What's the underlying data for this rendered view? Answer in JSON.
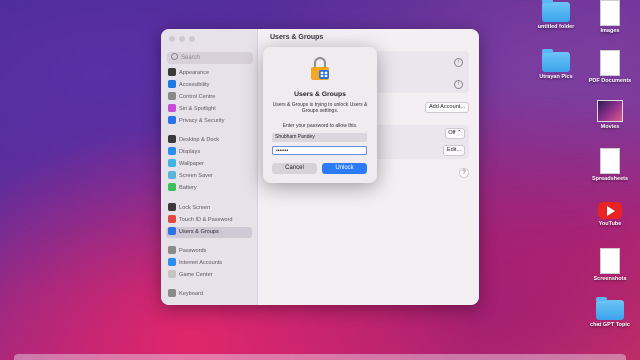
{
  "window": {
    "search_placeholder": "Search",
    "title": "Users & Groups",
    "sidebar": [
      {
        "label": "Appearance",
        "color": "#3a3a3a"
      },
      {
        "label": "Accessibility",
        "color": "#1f7ae0"
      },
      {
        "label": "Control Centre",
        "color": "#8a8a8a"
      },
      {
        "label": "Siri & Spotlight",
        "color": "#c94bd6"
      },
      {
        "label": "Privacy & Security",
        "color": "#2c74e6"
      },
      {
        "label": "Desktop & Dock",
        "color": "#3a3a3a"
      },
      {
        "label": "Displays",
        "color": "#2c8df0"
      },
      {
        "label": "Wallpaper",
        "color": "#3fb6e0"
      },
      {
        "label": "Screen Saver",
        "color": "#58b7d8"
      },
      {
        "label": "Battery",
        "color": "#39c15c"
      },
      {
        "label": "Lock Screen",
        "color": "#3a3a3a"
      },
      {
        "label": "Touch ID & Password",
        "color": "#e2483f"
      },
      {
        "label": "Users & Groups",
        "color": "#2c74e6"
      },
      {
        "label": "Passwords",
        "color": "#8a8a8a"
      },
      {
        "label": "Internet Accounts",
        "color": "#2c8df0"
      },
      {
        "label": "Game Center",
        "color": "#c4c4c4"
      },
      {
        "label": "Keyboard",
        "color": "#8a8a8a"
      }
    ],
    "add_account_label": "Add Account...",
    "off_label": "Off",
    "edit_label": "Edit...",
    "help_label": "?"
  },
  "dialog": {
    "title": "Users & Groups",
    "message": "Users & Groups is trying to unlock Users & Groups settings.",
    "prompt": "Enter your password to allow this.",
    "username": "Shubham Pandey",
    "password_mask": "•••••••",
    "cancel_label": "Cancel",
    "unlock_label": "Unlock"
  },
  "desktop": [
    {
      "label": "untitled folder",
      "kind": "folder"
    },
    {
      "label": "Images",
      "kind": "doc"
    },
    {
      "label": "Utrayan Pics",
      "kind": "folder"
    },
    {
      "label": "PDF Documents",
      "kind": "doc"
    },
    {
      "label": "Movies",
      "kind": "thumb"
    },
    {
      "label": "Spreadsheets",
      "kind": "doc"
    },
    {
      "label": "YouTube",
      "kind": "youtube"
    },
    {
      "label": "Screenshots",
      "kind": "doc"
    },
    {
      "label": "chat GPT Topic",
      "kind": "folder"
    }
  ]
}
